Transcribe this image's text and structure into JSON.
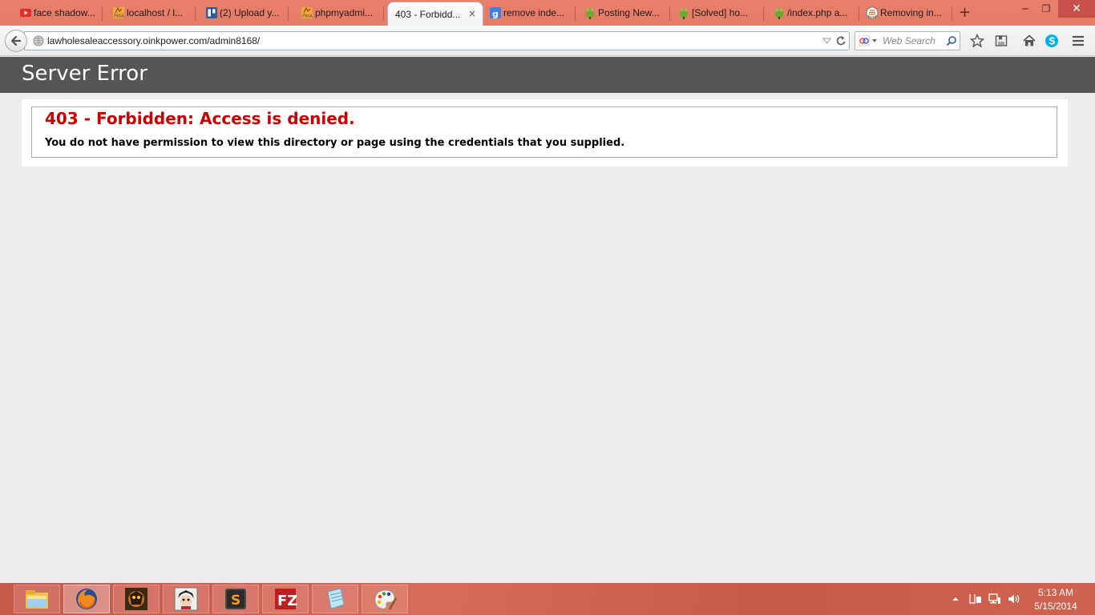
{
  "browser": {
    "tabs": [
      {
        "label": "face shadow...",
        "icon": "youtube-icon"
      },
      {
        "label": "localhost / l...",
        "icon": "phpmyadmin-icon"
      },
      {
        "label": "(2) Upload y...",
        "icon": "trello-icon"
      },
      {
        "label": "phpmyadmi...",
        "icon": "phpmyadmin-icon"
      },
      {
        "label": "403 - Forbidd...",
        "icon": "",
        "active": true,
        "close": "×"
      },
      {
        "label": "remove inde...",
        "icon": "google-icon"
      },
      {
        "label": "Posting New...",
        "icon": "green-frog-icon"
      },
      {
        "label": "[Solved] ho...",
        "icon": "green-frog-icon"
      },
      {
        "label": "/index.php a...",
        "icon": "green-frog-icon"
      },
      {
        "label": "Removing in...",
        "icon": "stack-icon"
      }
    ],
    "new_tab_label": "+",
    "window_controls": {
      "minimize": "─",
      "restore": "❐",
      "close": "✕"
    },
    "url": "lawholesaleaccessory.oinkpower.com/admin8168/",
    "search_placeholder": "Web Search"
  },
  "page": {
    "header_title": "Server Error",
    "error_title": "403 - Forbidden: Access is denied.",
    "error_message": "You do not have permission to view this directory or page using the credentials that you supplied."
  },
  "taskbar": {
    "apps": [
      "file-explorer-icon",
      "firefox-icon",
      "game-app-icon",
      "anime-app-icon",
      "sublime-text-icon",
      "filezilla-icon",
      "notepad-icon",
      "paint-icon"
    ],
    "time": "5:13 AM",
    "date": "5/15/2014"
  },
  "colors": {
    "tab_strip": "#e57a65",
    "header_bg": "#555555",
    "error_red": "#cc0000",
    "taskbar": "#cf6050"
  }
}
